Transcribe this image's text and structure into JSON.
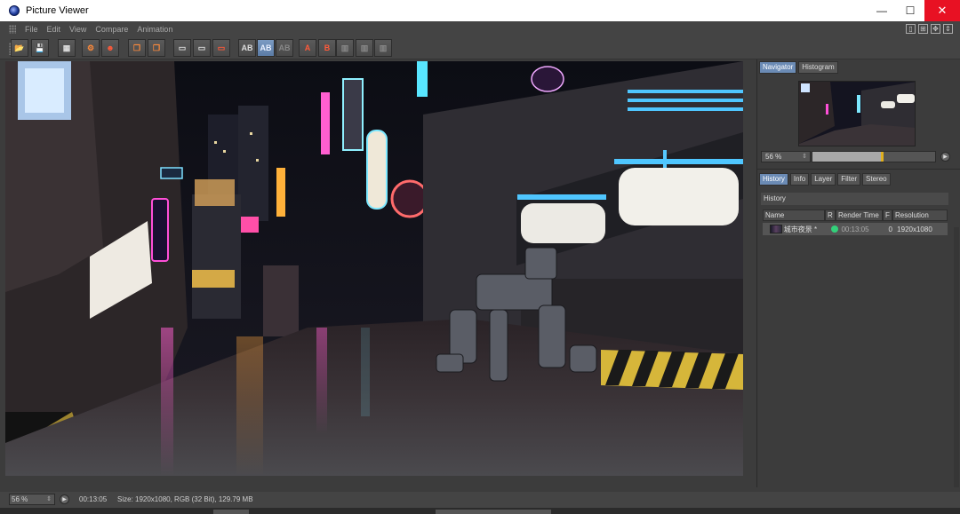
{
  "window": {
    "title": "Picture Viewer",
    "controls": {
      "minimize": "—",
      "maximize": "☐",
      "close": "✕"
    }
  },
  "menu": {
    "items": [
      "File",
      "Edit",
      "View",
      "Compare",
      "Animation"
    ],
    "right_icons": [
      "layout-single-icon",
      "layout-split-icon",
      "move-icon",
      "expand-icon"
    ]
  },
  "toolbar": {
    "buttons": [
      {
        "name": "open-icon",
        "glyph": "📂"
      },
      {
        "name": "save-icon",
        "glyph": "💾"
      },
      {
        "name": "grid-icon",
        "glyph": "▦"
      },
      {
        "name": "render-settings-icon",
        "glyph": "⚙"
      },
      {
        "name": "user-icon",
        "glyph": "☻"
      },
      {
        "name": "copy-icon",
        "glyph": "❐"
      },
      {
        "name": "layers-icon",
        "glyph": "❒"
      },
      {
        "name": "view-a-icon",
        "glyph": "▭"
      },
      {
        "name": "view-b-icon",
        "glyph": "▭"
      },
      {
        "name": "view-c-icon",
        "glyph": "▭"
      },
      {
        "name": "compare-ab-icon",
        "glyph": "AB"
      },
      {
        "name": "compare-ab-active-icon",
        "glyph": "AB"
      },
      {
        "name": "compare-ab-dim-icon",
        "glyph": "AB"
      },
      {
        "name": "set-a-icon",
        "glyph": "A"
      },
      {
        "name": "set-b-icon",
        "glyph": "B"
      },
      {
        "name": "split-a-icon",
        "glyph": "▥"
      },
      {
        "name": "split-b-icon",
        "glyph": "▥"
      },
      {
        "name": "split-c-icon",
        "glyph": "▥"
      }
    ]
  },
  "navigator": {
    "tabs": [
      "Navigator",
      "Histogram"
    ],
    "active_tab": "Navigator",
    "zoom": "56 %",
    "zoom_fraction": 0.56
  },
  "panel": {
    "tabs": [
      "History",
      "Info",
      "Layer",
      "Filter",
      "Stereo"
    ],
    "active_tab": "History",
    "section_title": "History",
    "columns": [
      "Name",
      "R",
      "Render Time",
      "F",
      "Resolution"
    ],
    "rows": [
      {
        "name": "城市夜景 *",
        "render_time": "00:13:05",
        "f": "0",
        "resolution": "1920x1080",
        "status_color": "#33d07a"
      }
    ]
  },
  "status": {
    "zoom": "56 %",
    "time": "00:13:05",
    "info": "Size: 1920x1080, RGB (32 Bit), 129.79 MB"
  },
  "colors": {
    "accent_tab": "#6b8bb5",
    "close_button": "#e81123",
    "render_ok": "#33d07a"
  }
}
